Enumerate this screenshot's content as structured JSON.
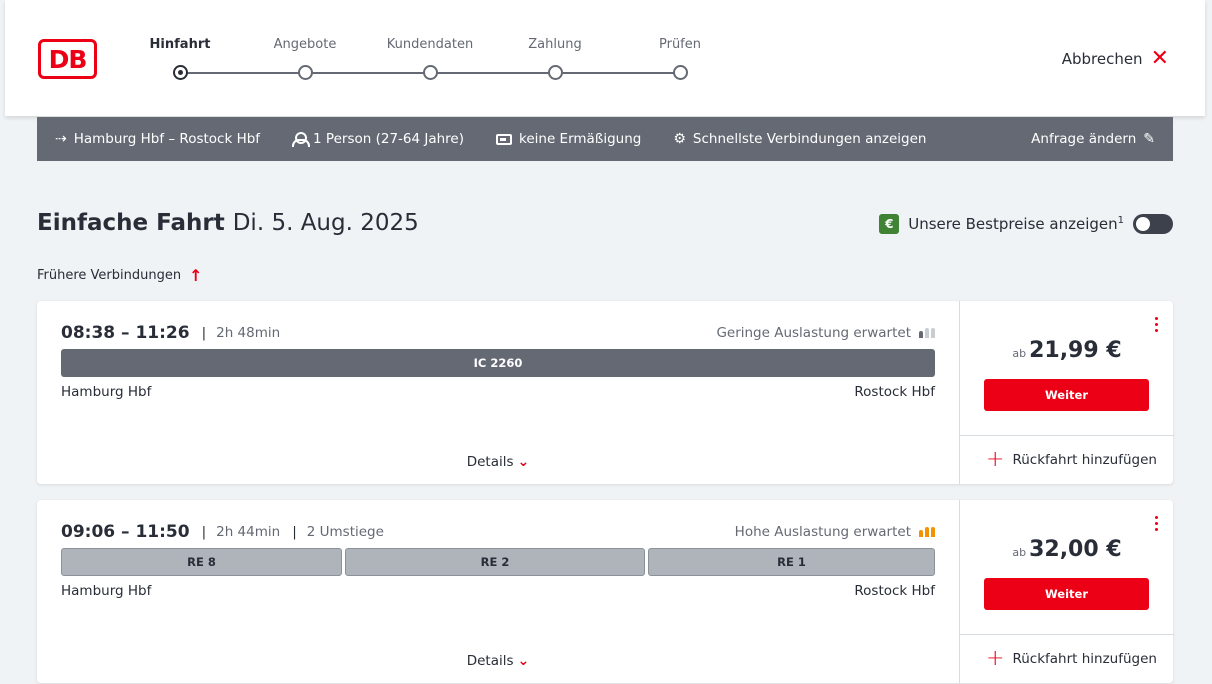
{
  "header": {
    "logo": "DB",
    "steps": [
      {
        "label": "Hinfahrt",
        "active": true
      },
      {
        "label": "Angebote",
        "active": false
      },
      {
        "label": "Kundendaten",
        "active": false
      },
      {
        "label": "Zahlung",
        "active": false
      },
      {
        "label": "Prüfen",
        "active": false
      }
    ],
    "cancel_label": "Abbrechen"
  },
  "summary": {
    "route": "Hamburg Hbf – Rostock Hbf",
    "travellers": "1 Person (27-64 Jahre)",
    "discount": "keine Ermäßigung",
    "filter": "Schnellste Verbindungen anzeigen",
    "edit_label": "Anfrage ändern"
  },
  "page": {
    "title": "Einfache Fahrt",
    "date": "Di. 5. Aug. 2025",
    "bestprice_badge": "€",
    "bestprice_label": "Unsere Bestpreise anzeigen",
    "bestprice_footnote": "1",
    "earlier_label": "Frühere Verbindungen"
  },
  "connections": [
    {
      "times": "08:38 – 11:26",
      "duration": "2h 48min",
      "changes": "",
      "load_text": "Geringe Auslastung erwartet",
      "trains": [
        "IC 2260"
      ],
      "from": "Hamburg Hbf",
      "to": "Rostock Hbf",
      "details_label": "Details",
      "price_prefix": "ab",
      "price": "21,99 €",
      "button_label": "Weiter",
      "return_label": "Rückfahrt hinzufügen"
    },
    {
      "times": "09:06 – 11:50",
      "duration": "2h 44min",
      "changes": "2 Umstiege",
      "load_text": "Hohe Auslastung erwartet",
      "trains": [
        "RE 8",
        "RE 2",
        "RE 1"
      ],
      "from": "Hamburg Hbf",
      "to": "Rostock Hbf",
      "details_label": "Details",
      "price_prefix": "ab",
      "price": "32,00 €",
      "button_label": "Weiter",
      "return_label": "Rückfahrt hinzufügen"
    }
  ],
  "colors": {
    "brand_red": "#ec0016",
    "load_low": "#c8cdd2",
    "load_high": "#f39200",
    "bestprice_green": "#408335"
  }
}
